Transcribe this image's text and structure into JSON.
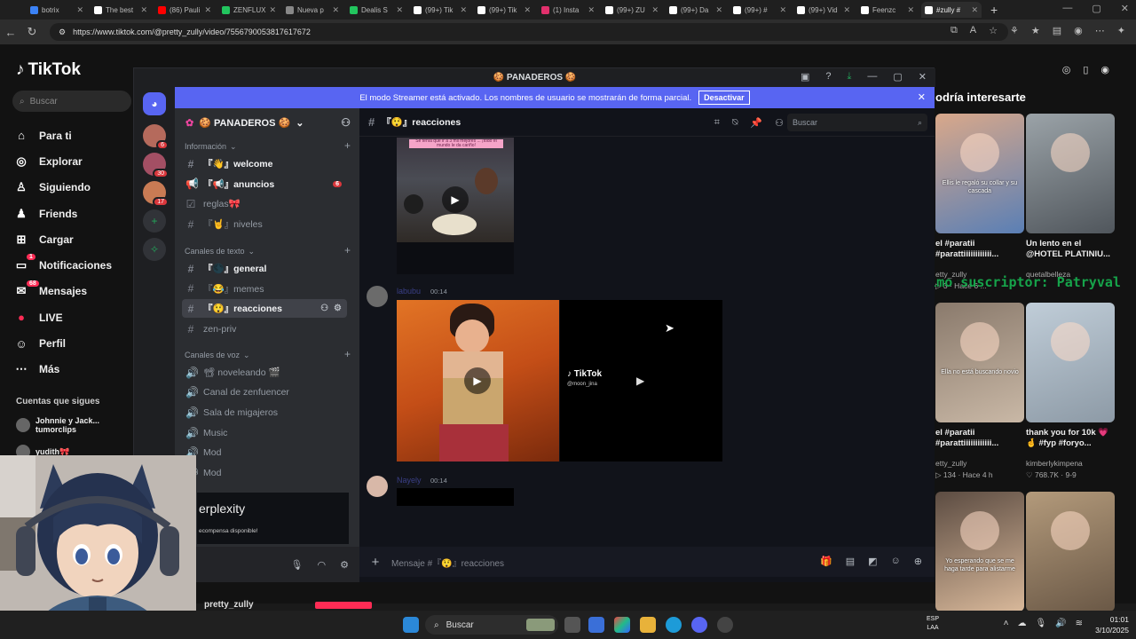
{
  "browser": {
    "tabs": [
      {
        "label": "botrix",
        "color": "#3b82f6"
      },
      {
        "label": "The best",
        "color": "#ffffff"
      },
      {
        "label": "(86) Pauli",
        "color": "#ff0000"
      },
      {
        "label": "ZENFLUX",
        "color": "#22c55e"
      },
      {
        "label": "Nueva p",
        "color": "#888888"
      },
      {
        "label": "Dealis S",
        "color": "#22c55e"
      },
      {
        "label": "(99+) Tik",
        "color": "#ffffff"
      },
      {
        "label": "(99+) Tik",
        "color": "#ffffff"
      },
      {
        "label": "(1) Insta",
        "color": "#e1306c"
      },
      {
        "label": "(99+) ZU",
        "color": "#ffffff"
      },
      {
        "label": "(99+) Da",
        "color": "#ffffff"
      },
      {
        "label": "(99+) #",
        "color": "#ffffff"
      },
      {
        "label": "(99+) Vid",
        "color": "#ffffff"
      },
      {
        "label": "Feenzc",
        "color": "#ffffff"
      },
      {
        "label": "#zully #",
        "color": "#ffffff"
      }
    ],
    "url": "https://www.tiktok.com/@pretty_zully/video/7556790053817617672"
  },
  "tiktok": {
    "logo": "TikTok",
    "search_placeholder": "Buscar",
    "nav": [
      {
        "icon": "⌂",
        "label": "Para ti"
      },
      {
        "icon": "◎",
        "label": "Explorar"
      },
      {
        "icon": "♙",
        "label": "Siguiendo"
      },
      {
        "icon": "♟",
        "label": "Friends"
      },
      {
        "icon": "⊞",
        "label": "Cargar"
      },
      {
        "icon": "▭",
        "label": "Notificaciones",
        "badge": "1"
      },
      {
        "icon": "✉",
        "label": "Mensajes",
        "badge": "68"
      },
      {
        "icon": "●",
        "label": "LIVE"
      },
      {
        "icon": "☺",
        "label": "Perfil"
      },
      {
        "icon": "⋯",
        "label": "Más"
      }
    ],
    "following_heading": "Cuentas que sigues",
    "following": [
      {
        "name": "Johnnie y Jack...",
        "sub": "tumorclips"
      },
      {
        "name": "yudith🎀",
        "sub": ""
      }
    ],
    "suggest_heading": "odría interesarte",
    "videos": [
      {
        "caption": "el #paratii #parattiiiiiiiiiiii...",
        "author": "etty_zully",
        "stats": "▷ 3 · Hace 6 ...",
        "overlay": "Ellis le regaló su collar y su cascada",
        "colors": [
          "#d9a88a",
          "#5a7fb5"
        ]
      },
      {
        "caption": "Un lento en el @HOTEL PLATINIU...",
        "author": "quetalbelleza",
        "stats": "",
        "overlay": "",
        "colors": [
          "#9ba3a8",
          "#50565c"
        ]
      },
      {
        "caption": "el #paratii #parattiiiiiiiiiiii...",
        "author": "etty_zully",
        "stats": "▷ 134 · Hace 4 h",
        "overlay": "Ella no está buscando novio",
        "colors": [
          "#8a7a6c",
          "#c9b8a6"
        ]
      },
      {
        "caption": "thank you for 10k 💗 🤞 #fyp #foryo...",
        "author": "kimberlykimpena",
        "stats": "♡ 768.7K · 9-9",
        "overlay": "",
        "colors": [
          "#c0cdd8",
          "#8d9aa6"
        ]
      },
      {
        "caption": "",
        "author": "",
        "stats": "",
        "overlay": "Yo esperando que se me haga tarde para alistarme",
        "colors": [
          "#5c4c42",
          "#d8b89a"
        ]
      },
      {
        "caption": "",
        "author": "",
        "stats": "",
        "overlay": "",
        "colors": [
          "#b39a7b",
          "#6a5846"
        ]
      }
    ],
    "stream_overlay": "último suscriptor: Patryval",
    "bottom_username": "pretty_zully"
  },
  "discord": {
    "window_title": "🍪 PANADEROS 🍪",
    "guild_badges": [
      "6",
      "30",
      "17"
    ],
    "streamer_banner": {
      "text": "El modo Streamer está activado. Los nombres de usuario se mostrarán de forma parcial.",
      "button": "Desactivar"
    },
    "server_name": "🍪 PANADEROS 🍪",
    "categories": {
      "info": "Información",
      "text": "Canales de texto",
      "voice": "Canales de voz"
    },
    "channels_info": [
      {
        "icon": "#",
        "name": "『👋』welcome",
        "bright": true
      },
      {
        "icon": "📢",
        "name": "『📢』anuncios",
        "bright": true,
        "badge": "6"
      },
      {
        "icon": "☑",
        "name": "reglas🎀",
        "bright": false
      },
      {
        "icon": "#",
        "name": "『🤘』niveles",
        "bright": false
      }
    ],
    "channels_text": [
      {
        "icon": "#",
        "name": "『🌑』general",
        "bright": true
      },
      {
        "icon": "#",
        "name": "『😂』memes",
        "bright": false
      },
      {
        "icon": "#",
        "name": "『😲』reacciones",
        "bright": true,
        "selected": true
      },
      {
        "icon": "#",
        "name": "zen-priv",
        "bright": false
      }
    ],
    "channels_voice": [
      {
        "icon": "🔊",
        "name": "📽 noveleando 🎬"
      },
      {
        "icon": "🔊",
        "name": "Canal de zenfuencer"
      },
      {
        "icon": "🔊",
        "name": "Sala de migajeros"
      },
      {
        "icon": "🔊",
        "name": "Music"
      },
      {
        "icon": "🔊",
        "name": "Mod"
      },
      {
        "icon": "🔊",
        "name": "Mod"
      }
    ],
    "promo": {
      "title": "erplexity",
      "subtitle": "ecompensa disponible!"
    },
    "chat": {
      "channel_name": "『😲』reacciones",
      "search_placeholder": "Buscar",
      "messages": [
        {
          "author": "",
          "time": "",
          "embed_caption": "Se tenía que ir a 3 mil mejores ... ¡todo el mundo le da cariño!"
        },
        {
          "author": "labubu",
          "time": "00:14",
          "embed_logo": "TikTok",
          "embed_handle": "@moon_jina"
        },
        {
          "author": "Nayely",
          "time": "00:14"
        }
      ],
      "composer_placeholder": "Mensaje #『😲』reacciones"
    }
  },
  "taskbar": {
    "search_placeholder": "Buscar",
    "lang": [
      "ESP",
      "LAA"
    ],
    "time": "01:01",
    "date": "3/10/2025"
  }
}
